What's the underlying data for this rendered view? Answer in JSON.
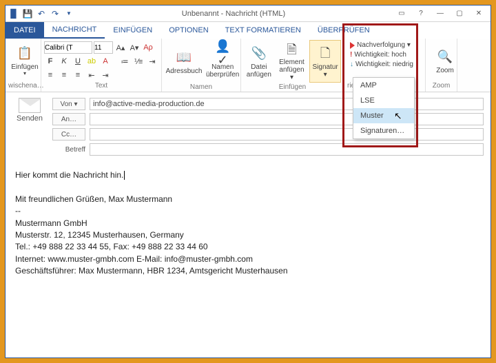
{
  "titlebar": {
    "title": "Unbenannt - Nachricht (HTML)"
  },
  "tabs": {
    "file": "DATEI",
    "items": [
      "NACHRICHT",
      "EINFÜGEN",
      "OPTIONEN",
      "TEXT FORMATIEREN",
      "ÜBERPRÜFEN"
    ]
  },
  "ribbon": {
    "clipboard": {
      "paste": "Einfügen",
      "label": "wischena…"
    },
    "font": {
      "family": "Calibri (T",
      "size": "11",
      "label": "Text"
    },
    "names": {
      "addressbook": "Adressbuch",
      "checknames": "Namen überprüfen",
      "label": "Namen"
    },
    "include": {
      "attachfile": "Datei anfügen",
      "attachitem": "Element anfügen ▾",
      "signature": "Signatur ▾",
      "label": "Einfügen"
    },
    "tags": {
      "followup": "Nachverfolgung ▾",
      "high": "Wichtigkeit: hoch",
      "low": "Wichtigkeit: niedrig",
      "label": "rier…"
    },
    "zoom": {
      "btn": "Zoom",
      "label": "Zoom"
    }
  },
  "sigmenu": {
    "items": [
      "AMP",
      "LSE",
      "Muster",
      "Signaturen…"
    ],
    "highlighted": 2
  },
  "header": {
    "send": "Senden",
    "von": "Von ▾",
    "von_value": "info@active-media-production.de",
    "an": "An…",
    "an_value": "",
    "cc": "Cc…",
    "cc_value": "",
    "betreff": "Betreff",
    "betreff_value": ""
  },
  "body": {
    "line1": "Hier kommt die Nachricht hin.",
    "greeting": "Mit freundlichen Grüßen, Max Mustermann",
    "sep": "--",
    "company": "Mustermann GmbH",
    "addr": "Musterstr. 12, 12345 Musterhausen, Germany",
    "tel": "Tel.: +49 888 22 33 44 55, Fax: +49 888 22 33 44 60",
    "web": "Internet: www.muster-gmbh.com E-Mail: info@muster-gmbh.com",
    "legal": "Geschäftsführer: Max Mustermann, HBR 1234, Amtsgericht Musterhausen"
  }
}
